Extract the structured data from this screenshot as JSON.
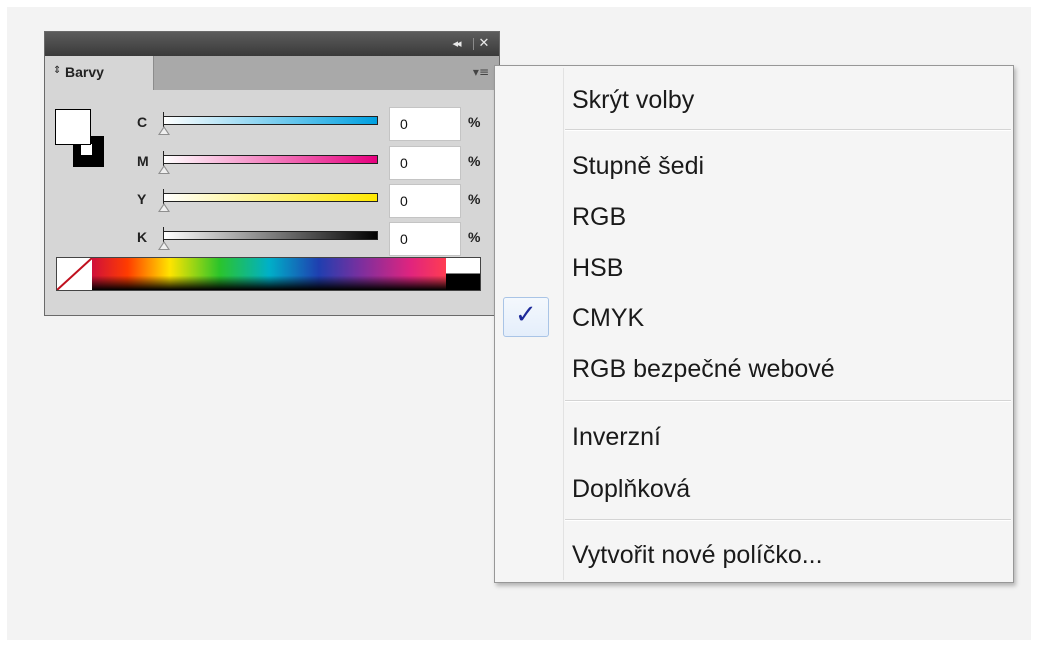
{
  "panel": {
    "tab_label": "Barvy",
    "tab_arrows": "⇕",
    "collapse_glyph": "◂◂",
    "close_glyph": "✕",
    "menu_glyph": "▾≡",
    "sliders": [
      {
        "label": "C",
        "value": "0",
        "unit": "%",
        "gradient_start": "#ffffff",
        "gradient_end": "#00a0e0"
      },
      {
        "label": "M",
        "value": "0",
        "unit": "%",
        "gradient_start": "#ffffff",
        "gradient_end": "#e6007e"
      },
      {
        "label": "Y",
        "value": "0",
        "unit": "%",
        "gradient_start": "#ffffff",
        "gradient_end": "#ffe800"
      },
      {
        "label": "K",
        "value": "0",
        "unit": "%",
        "gradient_start": "#ffffff",
        "gradient_end": "#000000"
      }
    ]
  },
  "menu": {
    "items": [
      {
        "label": "Skrýt volby",
        "checked": false
      },
      {
        "label": "Stupně šedi",
        "checked": false
      },
      {
        "label": "RGB",
        "checked": false
      },
      {
        "label": "HSB",
        "checked": false
      },
      {
        "label": "CMYK",
        "checked": true
      },
      {
        "label": "RGB bezpečné webové",
        "checked": false
      },
      {
        "label": "Inverzní",
        "checked": false
      },
      {
        "label": "Doplňková",
        "checked": false
      },
      {
        "label": "Vytvořit nové políčko...",
        "checked": false
      }
    ],
    "check_glyph": "✓"
  },
  "colors": {
    "menu_check": "#1d2a9a",
    "titlebar": "#3a3a3a"
  }
}
